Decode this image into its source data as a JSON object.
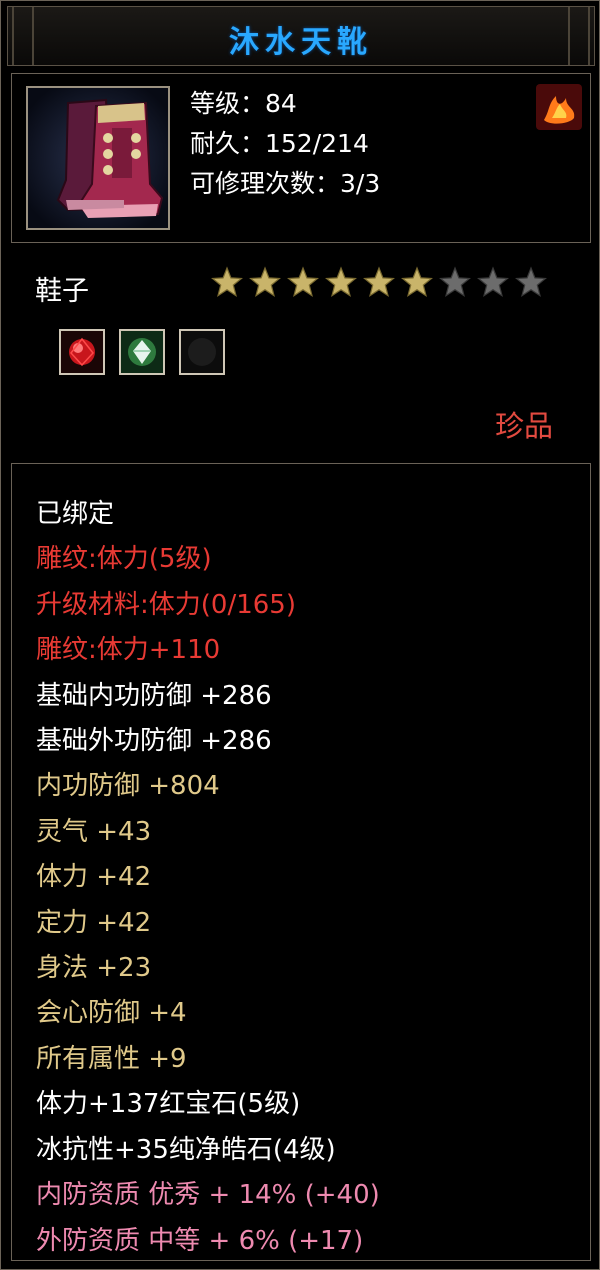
{
  "item": {
    "name": "沐水天靴",
    "category": "鞋子",
    "quality": "珍品",
    "level_line": "等级：84",
    "durability_line": "耐久：152/214",
    "repair_line": "可修理次数：3/3",
    "stars": {
      "filled": 6,
      "total": 9
    }
  },
  "gems": [
    "ruby-gem-icon",
    "diamond-gem-icon",
    "empty-gem-slot"
  ],
  "colors": {
    "title": "#29a8ff",
    "red": "#e83a34",
    "gold": "#e0c98a",
    "pink": "#ee8ab0",
    "quality": "#e24a40"
  },
  "attributes": [
    {
      "text": "已绑定",
      "color": "white"
    },
    {
      "text": "雕纹:体力(5级)",
      "color": "red"
    },
    {
      "text": "升级材料:体力(0/165)",
      "color": "red"
    },
    {
      "text": "雕纹:体力+110",
      "color": "red"
    },
    {
      "text": "基础内功防御 +286",
      "color": "white"
    },
    {
      "text": "基础外功防御 +286",
      "color": "white"
    },
    {
      "text": "内功防御 +804",
      "color": "gold"
    },
    {
      "text": "灵气 +43",
      "color": "gold"
    },
    {
      "text": "体力 +42",
      "color": "gold"
    },
    {
      "text": "定力 +42",
      "color": "gold"
    },
    {
      "text": "身法 +23",
      "color": "gold"
    },
    {
      "text": "会心防御 +4",
      "color": "gold"
    },
    {
      "text": "所有属性 +9",
      "color": "gold"
    },
    {
      "text": "体力+137红宝石(5级)",
      "color": "white"
    },
    {
      "text": "冰抗性+35纯净皓石(4级)",
      "color": "white"
    },
    {
      "text": "内防资质 优秀 + 14% (+40)",
      "color": "pink"
    },
    {
      "text": "外防资质 中等 + 6% (+17)",
      "color": "pink"
    }
  ]
}
